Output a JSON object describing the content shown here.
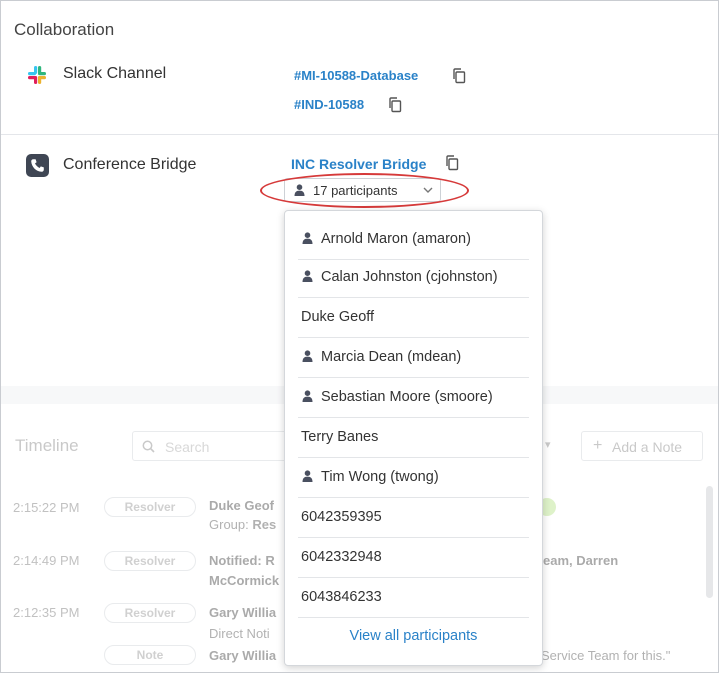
{
  "collaboration": {
    "title": "Collaboration",
    "slack": {
      "label": "Slack Channel",
      "channels": [
        "#MI-10588-Database",
        "#IND-10588"
      ]
    },
    "conference": {
      "label": "Conference Bridge",
      "bridge_link": "INC Resolver Bridge",
      "participants_button": "17 participants"
    }
  },
  "participants_dropdown": {
    "items": [
      {
        "name": "Arnold Maron (amaron)",
        "icon": "user-icon"
      },
      {
        "name": "Calan Johnston (cjohnston)",
        "icon": "user-icon"
      },
      {
        "name": "Duke Geoff",
        "icon": ""
      },
      {
        "name": "Marcia Dean (mdean)",
        "icon": "user-icon"
      },
      {
        "name": "Sebastian Moore (smoore)",
        "icon": "user-icon"
      },
      {
        "name": "Terry Banes",
        "icon": ""
      },
      {
        "name": "Tim Wong (twong)",
        "icon": "user-icon"
      },
      {
        "name": "6042359395",
        "icon": ""
      },
      {
        "name": "6042332948",
        "icon": ""
      },
      {
        "name": "6043846233",
        "icon": ""
      }
    ],
    "view_all": "View all participants"
  },
  "timeline": {
    "title": "Timeline",
    "search_placeholder": "Search",
    "add_note": "Add a Note",
    "entries": [
      {
        "time": "2:15:22 PM",
        "badge": "Resolver",
        "line1": "Duke Geof",
        "line2_prefix": "Group: ",
        "line2_bold": "Res"
      },
      {
        "time": "2:14:49 PM",
        "badge": "Resolver",
        "line1": "Notified: R",
        "line1_right": "eam, Darren",
        "line2": "McCormick"
      },
      {
        "time": "2:12:35 PM",
        "badge": "Resolver",
        "line1": "Gary Willia",
        "line2": "Direct Noti"
      },
      {
        "time": "",
        "badge": "Note",
        "line1": "Gary Willia",
        "line1_right": "Service Team for this.\""
      }
    ]
  },
  "colors": {
    "link": "#2a82c8",
    "highlight_ring": "#d63a3a",
    "phone_icon_bg": "#3f4654"
  }
}
